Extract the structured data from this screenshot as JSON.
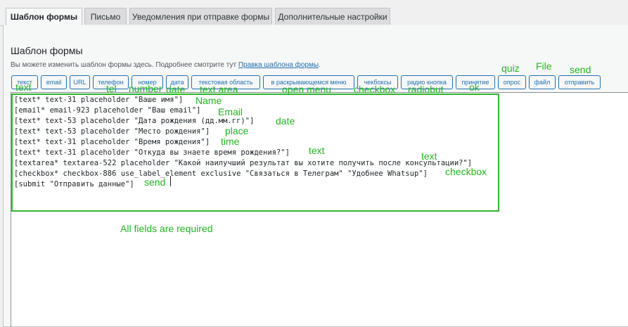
{
  "tabs": [
    {
      "label": "Шаблон формы"
    },
    {
      "label": "Письмо"
    },
    {
      "label": "Уведомления при отправке формы"
    },
    {
      "label": "Дополнительные настройки"
    }
  ],
  "section": {
    "title": "Шаблон формы",
    "description": "Вы можете изменить шаблон формы здесь. Подробнее смотрите тут",
    "link_text": "Правка шаблона формы",
    "description_end": "."
  },
  "tag_buttons": [
    {
      "label": "текст"
    },
    {
      "label": "email"
    },
    {
      "label": "URL"
    },
    {
      "label": "телефон"
    },
    {
      "label": "номер"
    },
    {
      "label": "дата"
    },
    {
      "label": "текстовая область"
    },
    {
      "label": "в раскрывающемся меню"
    },
    {
      "label": "чекбоксы"
    },
    {
      "label": "радио кнопка"
    },
    {
      "label": "принятие"
    },
    {
      "label": "опрос"
    },
    {
      "label": "файл"
    },
    {
      "label": "отправить"
    }
  ],
  "code_lines": [
    "[text* text-31 placeholder \"Ваше имя\"]",
    "[email* email-923 placeholder \"Ваш email\"]",
    "[text* text-53 placeholder \"Дата рождения (дд.мм.гг)\"]",
    "[text* text-53 placeholder \"Место рождения\"]",
    "[text* text-31 placeholder \"Время рождения\"]",
    "[text* text-31 placeholder \"Откуда вы знаете время рождения?\"]",
    "[textarea* textarea-522 placeholder \"Какой наилучший результат вы хотите получить после консультации?\"]",
    "[checkbox* checkbox-886 use_label_element exclusive \"Связаться в Телеграм\" \"Удобнее Whatsup\"]",
    "[submit \"Отправить данные\"]"
  ],
  "annotations": {
    "text": "text",
    "tel": "tel",
    "number": "number",
    "date": "date",
    "textarea": "text area",
    "open_menu": "open menu",
    "checkbox": "checkbox",
    "radio": "radiobut",
    "ok": "ok",
    "quiz": "quiz",
    "file": "File",
    "send": "send",
    "line_name": "Name",
    "line_email": "Email",
    "line_date": "date",
    "line_place": "place",
    "line_time": "time",
    "line_text1": "text",
    "line_text2": "text",
    "line_checkbox": "checkbox",
    "line_send": "send",
    "required": "All fields are required"
  },
  "colors": {
    "accent": "#2271b1",
    "annotation": "#22b522"
  }
}
